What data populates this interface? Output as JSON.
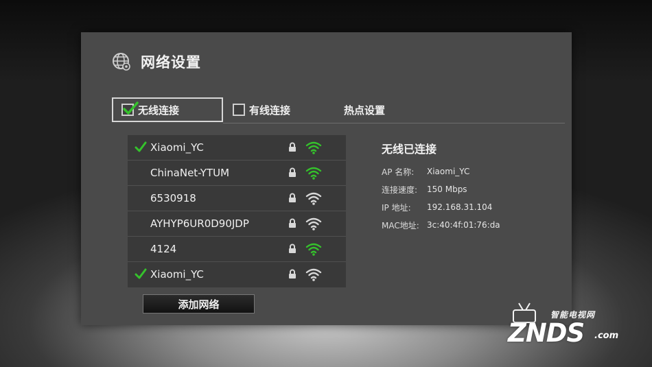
{
  "header": {
    "title": "网络设置",
    "icon": "globe-settings-icon"
  },
  "tabs": {
    "wireless": {
      "label": "无线连接",
      "checked": true
    },
    "wired": {
      "label": "有线连接",
      "checked": false
    },
    "hotspot": {
      "label": "热点设置"
    }
  },
  "wifi_list": [
    {
      "ssid": "Xiaomi_YC",
      "connected": true,
      "locked": true,
      "signal_color": "#35c22c"
    },
    {
      "ssid": "ChinaNet-YTUM",
      "connected": false,
      "locked": true,
      "signal_color": "#35c22c"
    },
    {
      "ssid": "6530918",
      "connected": false,
      "locked": true,
      "signal_color": "#d8d8d8"
    },
    {
      "ssid": "AYHYP6UR0D90JDP",
      "connected": false,
      "locked": true,
      "signal_color": "#d8d8d8"
    },
    {
      "ssid": "4124",
      "connected": false,
      "locked": true,
      "signal_color": "#35c22c"
    },
    {
      "ssid": "Xiaomi_YC",
      "connected": true,
      "locked": true,
      "signal_color": "#d8d8d8"
    }
  ],
  "add_network": {
    "label": "添加网络"
  },
  "status": {
    "title": "无线已连接",
    "rows": [
      {
        "label": "AP 名称:",
        "value": "Xiaomi_YC"
      },
      {
        "label": "连接速度:",
        "value": "150 Mbps"
      },
      {
        "label": "IP 地址:",
        "value": "192.168.31.104"
      },
      {
        "label": "MAC地址:",
        "value": "3c:40:4f:01:76:da"
      }
    ]
  },
  "watermark": {
    "cn": "智能电视网",
    "main": "ZNDS",
    "domain": ".com"
  },
  "colors": {
    "panel": "#4a4a4a",
    "list_bg": "#393939",
    "accent_green": "#35c22c"
  }
}
